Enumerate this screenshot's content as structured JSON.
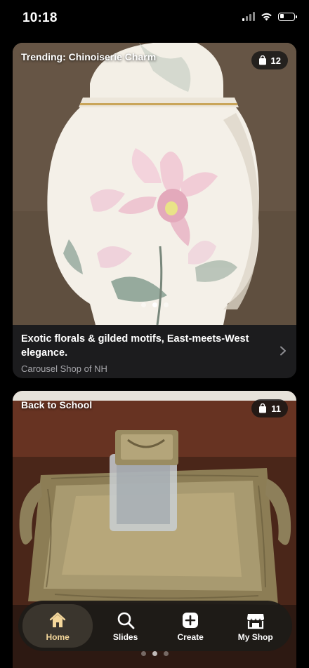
{
  "status_bar": {
    "time": "10:18",
    "icons": [
      "signal-icon",
      "wifi-icon",
      "battery-icon"
    ]
  },
  "feed": {
    "cards": [
      {
        "trend_label": "Trending: Chinoiserie Charm",
        "item_count": "12",
        "image": "ginger-jar-floral-porcelain",
        "description": "Exotic florals & gilded motifs, East-meets-West elegance.",
        "shop_name": "Carousel Shop of NH",
        "carousel_active_index": 1,
        "carousel_count": 3
      },
      {
        "trend_label": "Back to School",
        "item_count": "11",
        "image": "brass-inkwell-tray",
        "carousel_active_index": 1,
        "carousel_count": 3
      }
    ]
  },
  "bottom_nav": {
    "items": [
      {
        "label": "Home",
        "icon": "home-icon",
        "active": true
      },
      {
        "label": "Slides",
        "icon": "search-icon",
        "active": false
      },
      {
        "label": "Create",
        "icon": "plus-square-icon",
        "active": false
      },
      {
        "label": "My Shop",
        "icon": "storefront-icon",
        "active": false
      }
    ]
  },
  "colors": {
    "background": "#000000",
    "card_background": "#1c1c1e",
    "nav_background": "#1e1b18",
    "nav_active_pill": "#3a352d",
    "nav_active_accent": "#f3d69a",
    "secondary_text": "#a6a6ab"
  }
}
